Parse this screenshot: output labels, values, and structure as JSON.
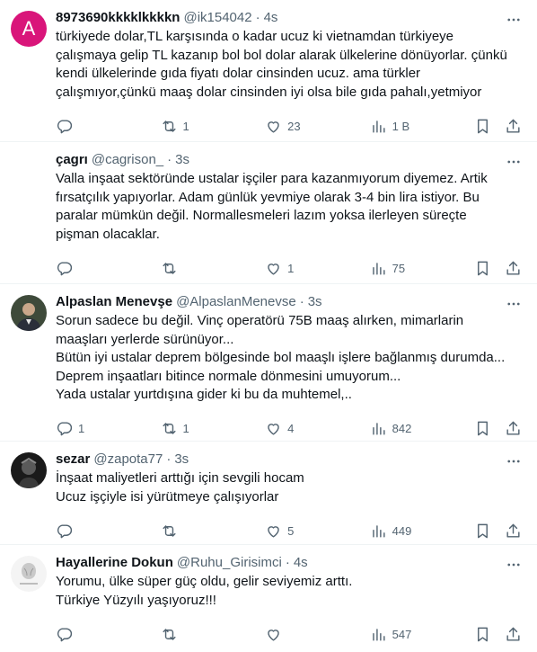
{
  "tweets": [
    {
      "avatar_letter": "A",
      "name": "8973690kkkklkkkkn",
      "handle": "@ik154042",
      "time": "4s",
      "text": "türkiyede dolar,TL karşısında o kadar ucuz ki vietnamdan türkiyeye\nçalışmaya gelip TL kazanıp bol bol dolar alarak ülkelerine dönüyorlar. çünkü\nkendi ülkelerinde gıda fiyatı dolar cinsinden ucuz. ama türkler\nçalışmıyor,çünkü maaş dolar cinsinden iyi olsa bile gıda pahalı,yetmiyor",
      "replies": "",
      "retweets": "1",
      "likes": "23",
      "views": "1 B"
    },
    {
      "avatar_letter": "",
      "name": "çagrı",
      "handle": "@cagrison_",
      "time": "3s",
      "text": "Valla inşaat sektöründe ustalar işçiler para kazanmıyorum diyemez. Artik\nfırsatçılık yapıyorlar. Adam günlük yevmiye olarak 3-4 bin lira istiyor. Bu\nparalar mümkün değil. Normallesmeleri lazım yoksa ilerleyen süreçte\npişman olacaklar.",
      "replies": "",
      "retweets": "",
      "likes": "1",
      "views": "75"
    },
    {
      "avatar_letter": "",
      "name": "Alpaslan Menevşe",
      "handle": "@AlpaslanMenevse",
      "time": "3s",
      "text": "Sorun sadece bu değil. Vinç operatörü 75B maaş alırken, mimarlarin\nmaaşları yerlerde sürünüyor...\nBütün iyi ustalar deprem bölgesinde bol maaşlı işlere bağlanmış durumda...\nDeprem inşaatları bitince normale dönmesini umuyorum...\nYada ustalar yurtdışına gider ki bu da muhtemel,..",
      "replies": "1",
      "retweets": "1",
      "likes": "4",
      "views": "842"
    },
    {
      "avatar_letter": "",
      "name": "sezar",
      "handle": "@zapota77",
      "time": "3s",
      "text": "İnşaat maliyetleri arttığı için sevgili hocam\nUcuz işçiyle isi yürütmeye çalışıyorlar",
      "replies": "",
      "retweets": "",
      "likes": "5",
      "views": "449"
    },
    {
      "avatar_letter": "",
      "name": "Hayallerine Dokun",
      "handle": "@Ruhu_Girisimci",
      "time": "4s",
      "text": "Yorumu, ülke süper güç oldu, gelir seviyemiz arttı.\nTürkiye Yüzyılı yaşıyoruz!!!",
      "replies": "",
      "retweets": "",
      "likes": "",
      "views": "547"
    }
  ],
  "colors": {
    "text": "#0f1419",
    "secondary": "#536471",
    "border": "#eff3f4",
    "avatar_a": "#d9157a"
  }
}
